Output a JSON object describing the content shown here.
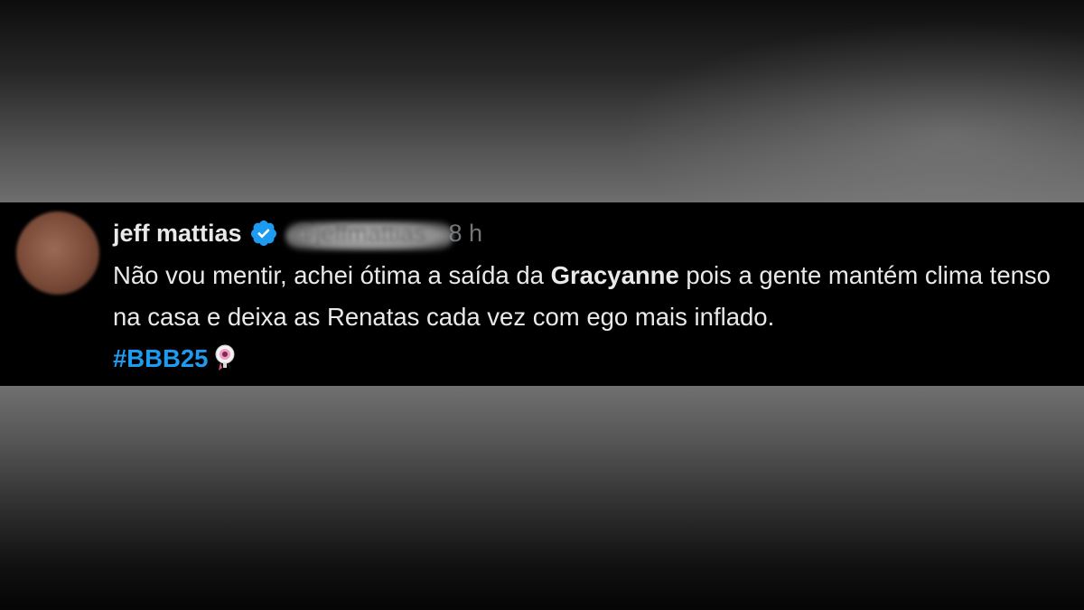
{
  "tweet": {
    "author_name": "jeff mattias",
    "handle": "@jeffmattias",
    "separator": "·",
    "timestamp": "8 h",
    "text_part1": "Não vou mentir, achei ótima a saída da ",
    "text_bold": "Gracyanne",
    "text_part2": " pois a gente mantém clima tenso na casa e deixa as Renatas cada vez com ego mais inflado.",
    "hashtag": "#BBB25",
    "emoji_icon": "bbb-mascot-emoji",
    "verified_icon": "verified-badge-icon",
    "colors": {
      "hashtag": "#1d9bf0",
      "verified": "#1d9bf0",
      "text": "#e7e9ea",
      "muted": "#71767b"
    }
  }
}
